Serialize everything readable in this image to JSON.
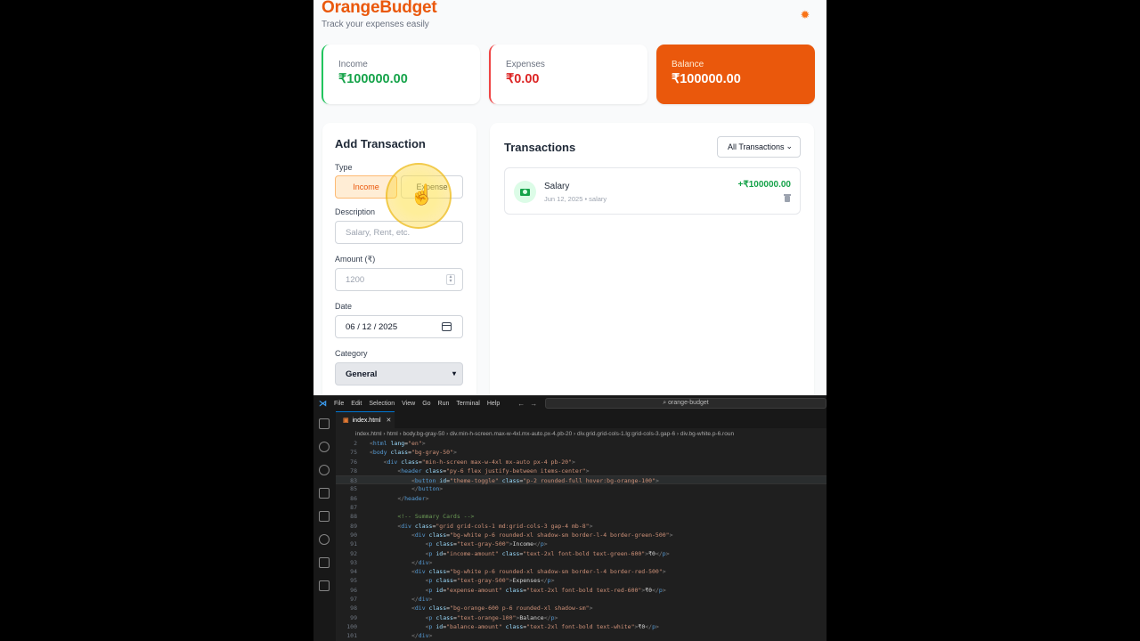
{
  "app": {
    "brand": "OrangeBudget",
    "tagline": "Track your expenses easily",
    "theme_icon": "gear-icon",
    "accent_color": "#ea580c",
    "summary": {
      "income": {
        "label": "Income",
        "amount": "₹100000.00"
      },
      "expenses": {
        "label": "Expenses",
        "amount": "₹0.00"
      },
      "balance": {
        "label": "Balance",
        "amount": "₹100000.00"
      }
    },
    "add_form": {
      "title": "Add Transaction",
      "type_label": "Type",
      "type_income": "Income",
      "type_expense": "Expense",
      "description_label": "Description",
      "description_placeholder": "Salary, Rent, etc.",
      "amount_label": "Amount (₹)",
      "amount_placeholder": "1200",
      "date_label": "Date",
      "date_value": "06 / 12 / 2025",
      "category_label": "Category",
      "category_value": "General"
    },
    "transactions": {
      "title": "Transactions",
      "filter_value": "All Transactions",
      "items": [
        {
          "name": "Salary",
          "meta": "Jun 12, 2025 • salary",
          "amount": "+₹100000.00"
        }
      ]
    }
  },
  "editor": {
    "menu": [
      "File",
      "Edit",
      "Selection",
      "View",
      "Go",
      "Run",
      "Terminal",
      "Help"
    ],
    "search": "⌕ orange-budget",
    "tab": {
      "icon": "html-file-icon",
      "name": "index.html",
      "close": "✕"
    },
    "breadcrumb": "index.html  ›  html  ›  body.bg-gray-50  ›  div.min-h-screen.max-w-4xl.mx-auto.px-4.pb-20  ›  div.grid.grid-cols-1.lg:grid-cols-3.gap-6  ›  div.bg-white.p-6.roun",
    "lines": [
      {
        "n": "2",
        "i": 0,
        "parts": [
          [
            "t-br",
            "<"
          ],
          [
            "t-tag",
            "html"
          ],
          [
            "t-attr",
            " lang"
          ],
          [
            "t-txt",
            "="
          ],
          [
            "t-str",
            "\"en\""
          ],
          [
            "t-br",
            ">"
          ]
        ]
      },
      {
        "n": "75",
        "i": 0,
        "parts": [
          [
            "t-br",
            "<"
          ],
          [
            "t-tag",
            "body"
          ],
          [
            "t-attr",
            " class"
          ],
          [
            "t-txt",
            "="
          ],
          [
            "t-str",
            "\"bg-gray-50\""
          ],
          [
            "t-br",
            ">"
          ]
        ]
      },
      {
        "n": "76",
        "i": 1,
        "parts": [
          [
            "t-br",
            "<"
          ],
          [
            "t-tag",
            "div"
          ],
          [
            "t-attr",
            " class"
          ],
          [
            "t-txt",
            "="
          ],
          [
            "t-str",
            "\"min-h-screen max-w-4xl mx-auto px-4 pb-20\""
          ],
          [
            "t-br",
            ">"
          ]
        ]
      },
      {
        "n": "78",
        "i": 2,
        "parts": [
          [
            "t-br",
            "<"
          ],
          [
            "t-tag",
            "header"
          ],
          [
            "t-attr",
            " class"
          ],
          [
            "t-txt",
            "="
          ],
          [
            "t-str",
            "\"py-6 flex justify-between items-center\""
          ],
          [
            "t-br",
            ">"
          ]
        ]
      },
      {
        "n": "83",
        "i": 3,
        "hl": true,
        "parts": [
          [
            "t-br",
            "<"
          ],
          [
            "t-tag",
            "button"
          ],
          [
            "t-attr",
            " id"
          ],
          [
            "t-txt",
            "="
          ],
          [
            "t-str",
            "\"theme-toggle\""
          ],
          [
            "t-attr",
            " class"
          ],
          [
            "t-txt",
            "="
          ],
          [
            "t-str",
            "\"p-2 rounded-full hover:bg-orange-100\""
          ],
          [
            "t-br",
            ">"
          ]
        ]
      },
      {
        "n": "85",
        "i": 3,
        "parts": [
          [
            "t-br",
            "</"
          ],
          [
            "t-tag",
            "button"
          ],
          [
            "t-br",
            ">"
          ]
        ]
      },
      {
        "n": "86",
        "i": 2,
        "parts": [
          [
            "t-br",
            "</"
          ],
          [
            "t-tag",
            "header"
          ],
          [
            "t-br",
            ">"
          ]
        ]
      },
      {
        "n": "87",
        "i": 0,
        "parts": []
      },
      {
        "n": "88",
        "i": 2,
        "parts": [
          [
            "t-com",
            "<!-- Summary Cards -->"
          ]
        ]
      },
      {
        "n": "89",
        "i": 2,
        "parts": [
          [
            "t-br",
            "<"
          ],
          [
            "t-tag",
            "div"
          ],
          [
            "t-attr",
            " class"
          ],
          [
            "t-txt",
            "="
          ],
          [
            "t-str",
            "\"grid grid-cols-1 md:grid-cols-3 gap-4 mb-8\""
          ],
          [
            "t-br",
            ">"
          ]
        ]
      },
      {
        "n": "90",
        "i": 3,
        "parts": [
          [
            "t-br",
            "<"
          ],
          [
            "t-tag",
            "div"
          ],
          [
            "t-attr",
            " class"
          ],
          [
            "t-txt",
            "="
          ],
          [
            "t-str",
            "\"bg-white p-6 rounded-xl shadow-sm border-l-4 border-green-500\""
          ],
          [
            "t-br",
            ">"
          ]
        ]
      },
      {
        "n": "91",
        "i": 4,
        "parts": [
          [
            "t-br",
            "<"
          ],
          [
            "t-tag",
            "p"
          ],
          [
            "t-attr",
            " class"
          ],
          [
            "t-txt",
            "="
          ],
          [
            "t-str",
            "\"text-gray-500\""
          ],
          [
            "t-br",
            ">"
          ],
          [
            "t-txt",
            "Income"
          ],
          [
            "t-br",
            "</"
          ],
          [
            "t-tag",
            "p"
          ],
          [
            "t-br",
            ">"
          ]
        ]
      },
      {
        "n": "92",
        "i": 4,
        "parts": [
          [
            "t-br",
            "<"
          ],
          [
            "t-tag",
            "p"
          ],
          [
            "t-attr",
            " id"
          ],
          [
            "t-txt",
            "="
          ],
          [
            "t-str",
            "\"income-amount\""
          ],
          [
            "t-attr",
            " class"
          ],
          [
            "t-txt",
            "="
          ],
          [
            "t-str",
            "\"text-2xl font-bold text-green-600\""
          ],
          [
            "t-br",
            ">"
          ],
          [
            "t-txt",
            "₹0"
          ],
          [
            "t-br",
            "</"
          ],
          [
            "t-tag",
            "p"
          ],
          [
            "t-br",
            ">"
          ]
        ]
      },
      {
        "n": "93",
        "i": 3,
        "parts": [
          [
            "t-br",
            "</"
          ],
          [
            "t-tag",
            "div"
          ],
          [
            "t-br",
            ">"
          ]
        ]
      },
      {
        "n": "94",
        "i": 3,
        "parts": [
          [
            "t-br",
            "<"
          ],
          [
            "t-tag",
            "div"
          ],
          [
            "t-attr",
            " class"
          ],
          [
            "t-txt",
            "="
          ],
          [
            "t-str",
            "\"bg-white p-6 rounded-xl shadow-sm border-l-4 border-red-500\""
          ],
          [
            "t-br",
            ">"
          ]
        ]
      },
      {
        "n": "95",
        "i": 4,
        "parts": [
          [
            "t-br",
            "<"
          ],
          [
            "t-tag",
            "p"
          ],
          [
            "t-attr",
            " class"
          ],
          [
            "t-txt",
            "="
          ],
          [
            "t-str",
            "\"text-gray-500\""
          ],
          [
            "t-br",
            ">"
          ],
          [
            "t-txt",
            "Expenses"
          ],
          [
            "t-br",
            "</"
          ],
          [
            "t-tag",
            "p"
          ],
          [
            "t-br",
            ">"
          ]
        ]
      },
      {
        "n": "96",
        "i": 4,
        "parts": [
          [
            "t-br",
            "<"
          ],
          [
            "t-tag",
            "p"
          ],
          [
            "t-attr",
            " id"
          ],
          [
            "t-txt",
            "="
          ],
          [
            "t-str",
            "\"expense-amount\""
          ],
          [
            "t-attr",
            " class"
          ],
          [
            "t-txt",
            "="
          ],
          [
            "t-str",
            "\"text-2xl font-bold text-red-600\""
          ],
          [
            "t-br",
            ">"
          ],
          [
            "t-txt",
            "₹0"
          ],
          [
            "t-br",
            "</"
          ],
          [
            "t-tag",
            "p"
          ],
          [
            "t-br",
            ">"
          ]
        ]
      },
      {
        "n": "97",
        "i": 3,
        "parts": [
          [
            "t-br",
            "</"
          ],
          [
            "t-tag",
            "div"
          ],
          [
            "t-br",
            ">"
          ]
        ]
      },
      {
        "n": "98",
        "i": 3,
        "parts": [
          [
            "t-br",
            "<"
          ],
          [
            "t-tag",
            "div"
          ],
          [
            "t-attr",
            " class"
          ],
          [
            "t-txt",
            "="
          ],
          [
            "t-str",
            "\"bg-orange-600 p-6 rounded-xl shadow-sm\""
          ],
          [
            "t-br",
            ">"
          ]
        ]
      },
      {
        "n": "99",
        "i": 4,
        "parts": [
          [
            "t-br",
            "<"
          ],
          [
            "t-tag",
            "p"
          ],
          [
            "t-attr",
            " class"
          ],
          [
            "t-txt",
            "="
          ],
          [
            "t-str",
            "\"text-orange-100\""
          ],
          [
            "t-br",
            ">"
          ],
          [
            "t-txt",
            "Balance"
          ],
          [
            "t-br",
            "</"
          ],
          [
            "t-tag",
            "p"
          ],
          [
            "t-br",
            ">"
          ]
        ]
      },
      {
        "n": "100",
        "i": 4,
        "parts": [
          [
            "t-br",
            "<"
          ],
          [
            "t-tag",
            "p"
          ],
          [
            "t-attr",
            " id"
          ],
          [
            "t-txt",
            "="
          ],
          [
            "t-str",
            "\"balance-amount\""
          ],
          [
            "t-attr",
            " class"
          ],
          [
            "t-txt",
            "="
          ],
          [
            "t-str",
            "\"text-2xl font-bold text-white\""
          ],
          [
            "t-br",
            ">"
          ],
          [
            "t-txt",
            "₹0"
          ],
          [
            "t-br",
            "</"
          ],
          [
            "t-tag",
            "p"
          ],
          [
            "t-br",
            ">"
          ]
        ]
      },
      {
        "n": "101",
        "i": 3,
        "parts": [
          [
            "t-br",
            "</"
          ],
          [
            "t-tag",
            "div"
          ],
          [
            "t-br",
            ">"
          ]
        ]
      }
    ]
  }
}
